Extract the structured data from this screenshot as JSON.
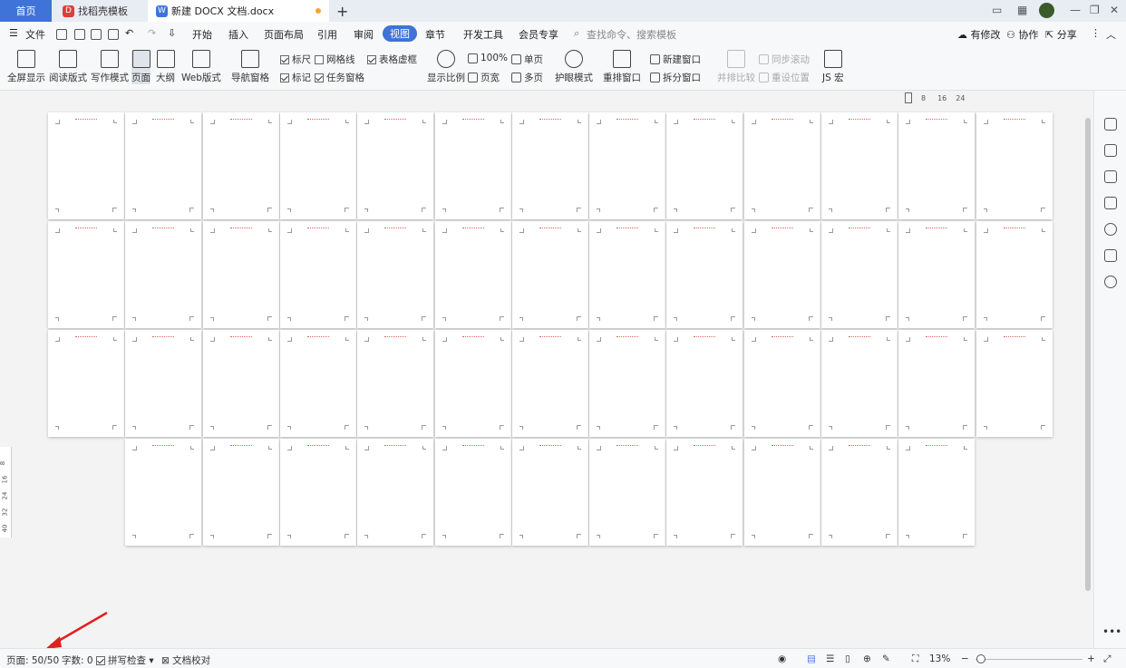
{
  "tabs": {
    "home": "首页",
    "template": "找稻壳模板",
    "doc": "新建 DOCX 文档.docx"
  },
  "menu": {
    "file": "文件",
    "items": [
      "开始",
      "插入",
      "页面布局",
      "引用",
      "审阅",
      "视图",
      "章节",
      "开发工具",
      "会员专享"
    ],
    "search_placeholder": "查找命令、搜索模板",
    "has_changes": "有修改",
    "collab": "协作",
    "share": "分享"
  },
  "ribbon": {
    "fullscreen": "全屏显示",
    "reading": "阅读版式",
    "writing": "写作模式",
    "page": "页面",
    "outline": "大纲",
    "web": "Web版式",
    "nav_pane": "导航窗格",
    "ruler": "标尺",
    "gridlines": "网格线",
    "table_gridlines": "表格虚框",
    "marks": "标记",
    "task_pane": "任务窗格",
    "zoom": "显示比例",
    "zoom100": "100%",
    "page_width": "页宽",
    "single_page": "单页",
    "multi_page": "多页",
    "eye_mode": "护眼模式",
    "arrange": "重排窗口",
    "new_window": "新建窗口",
    "split_window": "拆分窗口",
    "side_by_side": "并排比较",
    "sync_scroll": "同步滚动",
    "reset_pos": "重设位置",
    "js_macro": "JS 宏"
  },
  "ruler_marks": [
    "8",
    "16",
    "24"
  ],
  "vruler_marks": [
    "8",
    "16",
    "24",
    "32",
    "40"
  ],
  "status": {
    "page": "页面: 50/50",
    "words": "字数: 0",
    "spell": "拼写检查",
    "proof": "文档校对",
    "zoom": "13%"
  },
  "colors": {
    "accent": "#3f73d8",
    "arrow": "#e02020"
  },
  "total_pages": 50
}
